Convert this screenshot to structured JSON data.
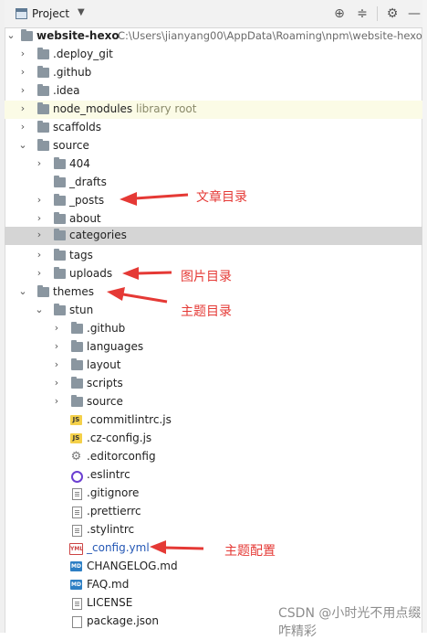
{
  "toolbar": {
    "title": "Project",
    "dropdown_arrow": "▼",
    "locate": "⊕",
    "collapse": "≑",
    "settings": "⚙",
    "hide": "—"
  },
  "tree": {
    "root": {
      "name": "website-hexo",
      "path": "C:\\Users\\jianyang00\\AppData\\Roaming\\npm\\website-hexo"
    },
    "deploy_git": ".deploy_git",
    "github": ".github",
    "idea": ".idea",
    "node_modules": "node_modules",
    "library_root": "library root",
    "scaffolds": "scaffolds",
    "source": "source",
    "folder_404": "404",
    "drafts": "_drafts",
    "posts": "_posts",
    "about": "about",
    "categories": "categories",
    "tags": "tags",
    "uploads": "uploads",
    "themes": "themes",
    "stun": "stun",
    "stun_github": ".github",
    "languages": "languages",
    "layout": "layout",
    "scripts": "scripts",
    "stun_source": "source",
    "commitlintrc": ".commitlintrc.js",
    "czconfig": ".cz-config.js",
    "editorconfig": ".editorconfig",
    "eslintrc": ".eslintrc",
    "gitignore": ".gitignore",
    "prettierrc": ".prettierrc",
    "stylintrc": ".stylintrc",
    "config_yml": "_config.yml",
    "changelog": "CHANGELOG.md",
    "faq": "FAQ.md",
    "license": "LICENSE",
    "package_json": "package.json"
  },
  "icons": {
    "js": "JS",
    "yml": "YML",
    "md": "MD"
  },
  "annotations": {
    "posts_note": "文章目录",
    "uploads_note": "图片目录",
    "themes_note": "主题目录",
    "config_note": "主题配置"
  },
  "watermark": "CSDN @小时光不用点缀咋精彩",
  "colors": {
    "annotation_red": "#e53935",
    "selected_row": "#d5d5d5",
    "library_bg": "#fbfbe6"
  }
}
